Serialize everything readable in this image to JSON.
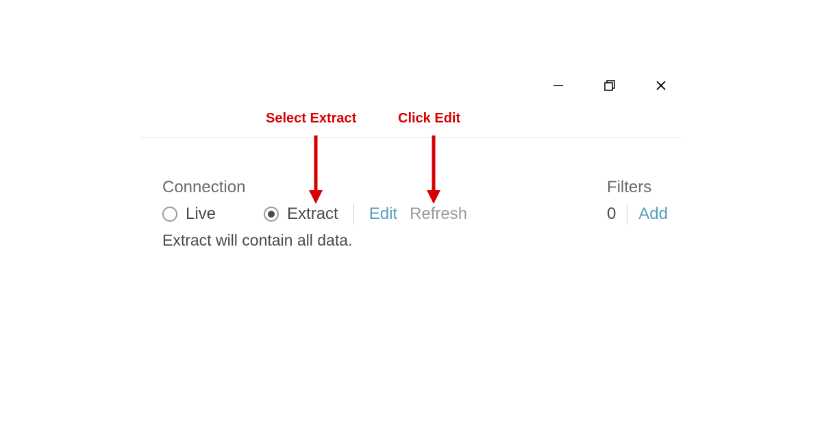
{
  "annotations": {
    "select_extract": "Select Extract",
    "click_edit": "Click Edit"
  },
  "connection": {
    "header": "Connection",
    "live_label": "Live",
    "extract_label": "Extract",
    "edit_label": "Edit",
    "refresh_label": "Refresh",
    "status": "Extract will contain all data."
  },
  "filters": {
    "header": "Filters",
    "count": "0",
    "add_label": "Add"
  }
}
